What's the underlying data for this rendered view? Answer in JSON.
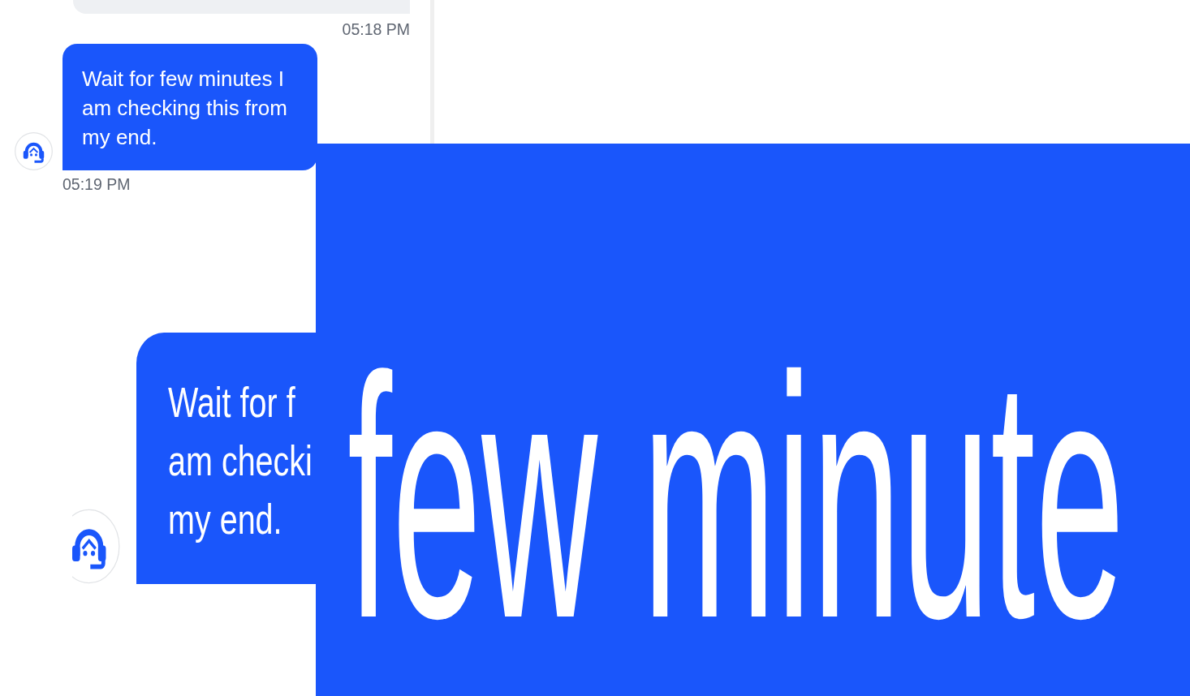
{
  "chat": {
    "messages": [
      {
        "kind": "user",
        "time": "05:18 PM"
      },
      {
        "kind": "agent",
        "text": "Wait for few minutes I am checking this from my end.",
        "time": "05:19 PM"
      }
    ]
  },
  "zoom_inset": {
    "message_lines": [
      "Wait for f",
      "am checki",
      "my end."
    ]
  },
  "zoom_closeup": {
    "text": "few minute"
  }
}
